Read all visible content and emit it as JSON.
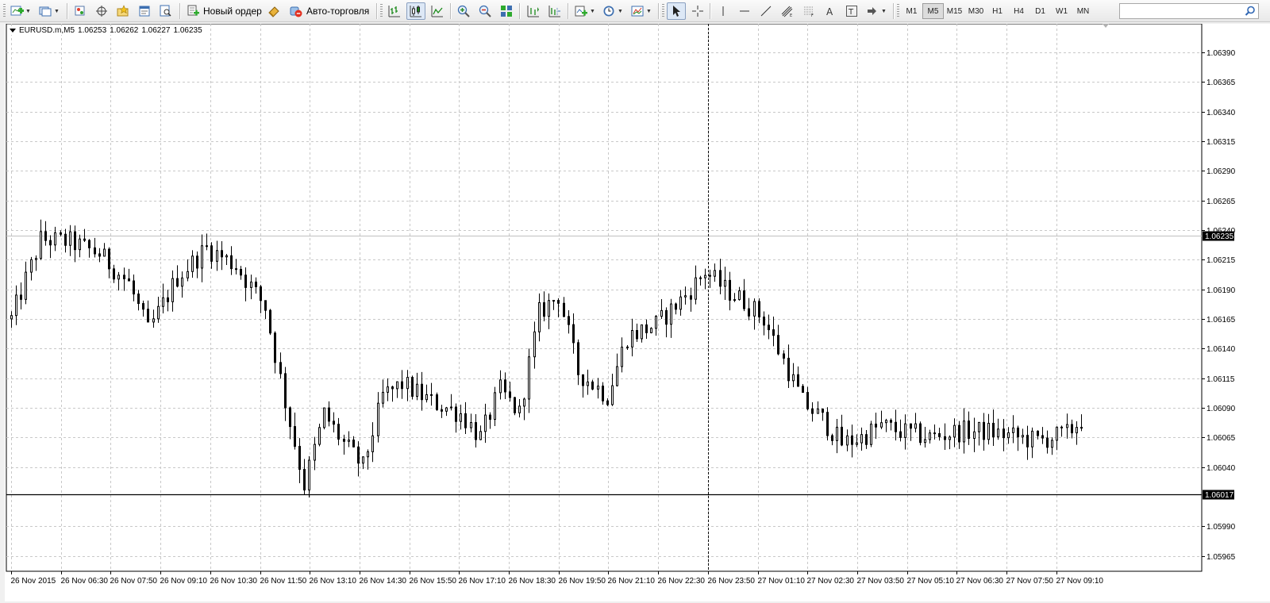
{
  "toolbar": {
    "new_order_label": "Новый ордер",
    "auto_trading_label": "Авто-торговля",
    "timeframes": [
      "M1",
      "M5",
      "M15",
      "M30",
      "H1",
      "H4",
      "D1",
      "W1",
      "MN"
    ],
    "active_timeframe": "M5",
    "search_value": ""
  },
  "chart_header": {
    "symbol": "EURUSD.m,M5",
    "open": "1.06253",
    "high": "1.06262",
    "low": "1.06227",
    "close": "1.06235"
  },
  "chart_data": {
    "type": "candlestick",
    "symbol": "EURUSD.m",
    "timeframe": "M5",
    "ylim": [
      1.05952,
      1.06414
    ],
    "y_ticks": [
      "1.06390",
      "1.06365",
      "1.06340",
      "1.06315",
      "1.06290",
      "1.06265",
      "1.06240",
      "1.06215",
      "1.06190",
      "1.06165",
      "1.06140",
      "1.06115",
      "1.06090",
      "1.06065",
      "1.06040",
      "1.06017",
      "1.05990",
      "1.05965"
    ],
    "x_ticks": [
      "26 Nov 2015",
      "26 Nov 06:30",
      "26 Nov 07:50",
      "26 Nov 09:10",
      "26 Nov 10:30",
      "26 Nov 11:50",
      "26 Nov 13:10",
      "26 Nov 14:30",
      "26 Nov 15:50",
      "26 Nov 17:10",
      "26 Nov 18:30",
      "26 Nov 19:50",
      "26 Nov 21:10",
      "26 Nov 22:30",
      "26 Nov 23:50",
      "27 Nov 01:10",
      "27 Nov 02:30",
      "27 Nov 03:50",
      "27 Nov 05:10",
      "27 Nov 06:30",
      "27 Nov 07:50",
      "27 Nov 09:10"
    ],
    "price_lines": [
      {
        "label": "1.06235",
        "value": 1.06235,
        "style": "bid"
      },
      {
        "label": "1.06017",
        "value": 1.06017,
        "style": "level"
      }
    ],
    "crosshair_x_label": "26 Nov 23:50",
    "grid": true,
    "candle_count": 220,
    "anchors": [
      [
        0,
        1.06165
      ],
      [
        6,
        1.06232
      ],
      [
        12,
        1.0623
      ],
      [
        18,
        1.0622
      ],
      [
        24,
        1.06195
      ],
      [
        28,
        1.06155
      ],
      [
        34,
        1.062
      ],
      [
        40,
        1.06225
      ],
      [
        46,
        1.0621
      ],
      [
        52,
        1.06175
      ],
      [
        56,
        1.06095
      ],
      [
        60,
        1.06025
      ],
      [
        64,
        1.06085
      ],
      [
        68,
        1.0606
      ],
      [
        72,
        1.0604
      ],
      [
        76,
        1.061
      ],
      [
        80,
        1.0611
      ],
      [
        86,
        1.06095
      ],
      [
        92,
        1.06085
      ],
      [
        96,
        1.06065
      ],
      [
        100,
        1.06105
      ],
      [
        104,
        1.06085
      ],
      [
        108,
        1.0617
      ],
      [
        112,
        1.06185
      ],
      [
        116,
        1.0612
      ],
      [
        122,
        1.061
      ],
      [
        126,
        1.0615
      ],
      [
        132,
        1.0616
      ],
      [
        138,
        1.06185
      ],
      [
        142,
        1.06205
      ],
      [
        146,
        1.0619
      ],
      [
        150,
        1.0618
      ],
      [
        154,
        1.06165
      ],
      [
        158,
        1.0613
      ],
      [
        162,
        1.06095
      ],
      [
        166,
        1.0608
      ],
      [
        170,
        1.0606
      ],
      [
        174,
        1.06065
      ],
      [
        178,
        1.06075
      ],
      [
        182,
        1.0607
      ],
      [
        188,
        1.06065
      ],
      [
        194,
        1.0607
      ],
      [
        200,
        1.0607
      ],
      [
        206,
        1.06065
      ],
      [
        210,
        1.06062
      ],
      [
        216,
        1.06068
      ],
      [
        219,
        1.0608
      ]
    ]
  }
}
